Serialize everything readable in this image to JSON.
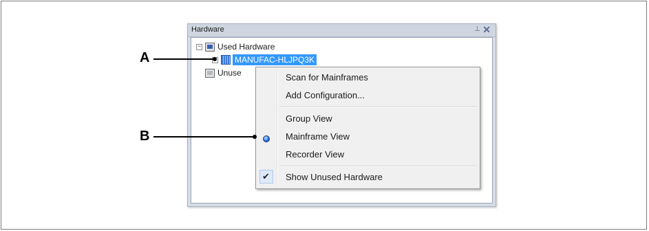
{
  "panel": {
    "title": "Hardware",
    "pin_glyph": "⊥",
    "close_glyph": "✕"
  },
  "tree": {
    "used_hardware": {
      "label": "Used Hardware",
      "expander": "−",
      "icon": "hardware-icon"
    },
    "mainframe": {
      "label": "MANUFAC-HLJPQ3K",
      "expander": "+",
      "icon": "mainframe-icon",
      "selected": true
    },
    "unused_hardware": {
      "label": "Unuse",
      "icon": "unused-hardware-icon"
    }
  },
  "context_menu": {
    "items": [
      {
        "label": "Scan for Mainframes"
      },
      {
        "label": "Add Configuration..."
      },
      {
        "label": "Group View"
      },
      {
        "label": "Mainframe View",
        "selected_radio": true
      },
      {
        "label": "Recorder View"
      },
      {
        "label": "Show Unused Hardware",
        "checked": true
      }
    ],
    "check_glyph": "✔"
  },
  "callouts": {
    "a": "A",
    "b": "B"
  },
  "colors": {
    "selection": "#3399ff",
    "panel_bg": "#d7dce5",
    "menu_bg": "#f0f0f0"
  }
}
